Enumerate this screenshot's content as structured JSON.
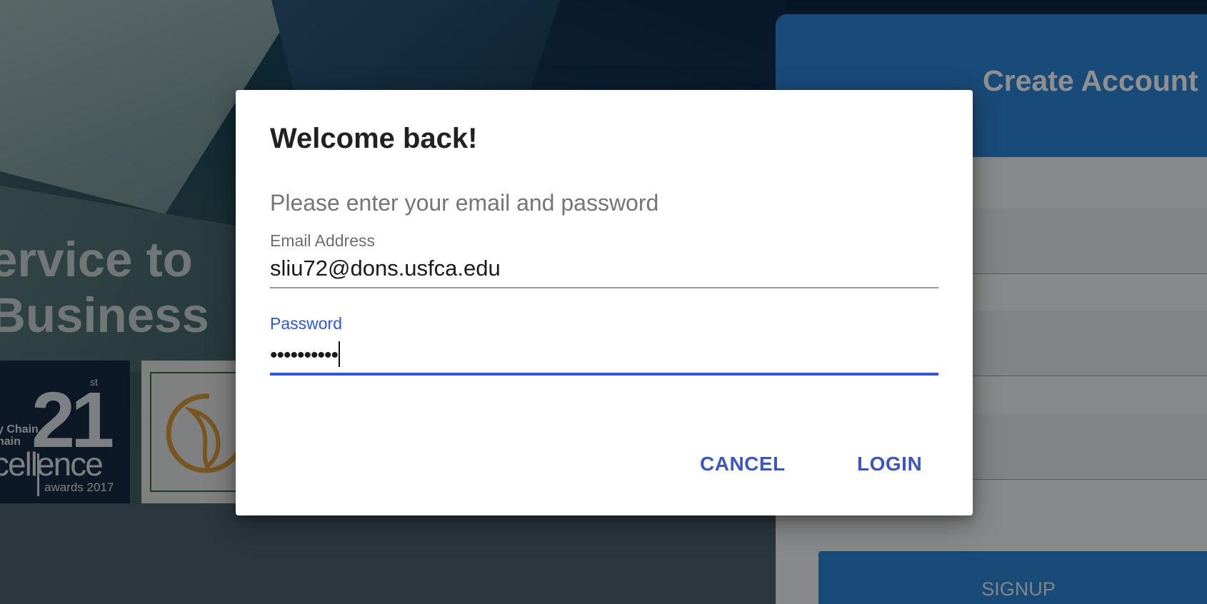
{
  "background": {
    "hero_line1": "Service to",
    "hero_line2": "r Business",
    "award": {
      "number": "21",
      "suffix": "st",
      "caption_line1": "y Chain",
      "caption_line2": "hain",
      "word": "cellence",
      "year": "awards 2017"
    },
    "signup_panel": {
      "title": "Create Account",
      "button_label": "SIGNUP"
    }
  },
  "dialog": {
    "title": "Welcome back!",
    "subtitle": "Please enter your email and password",
    "email": {
      "label": "Email Address",
      "value": "sliu72@dons.usfca.edu"
    },
    "password": {
      "label": "Password",
      "value": "••••••••••"
    },
    "cancel_label": "CANCEL",
    "login_label": "LOGIN",
    "colors": {
      "accent": "#2b57e8",
      "button_text": "#3b56c4"
    }
  }
}
